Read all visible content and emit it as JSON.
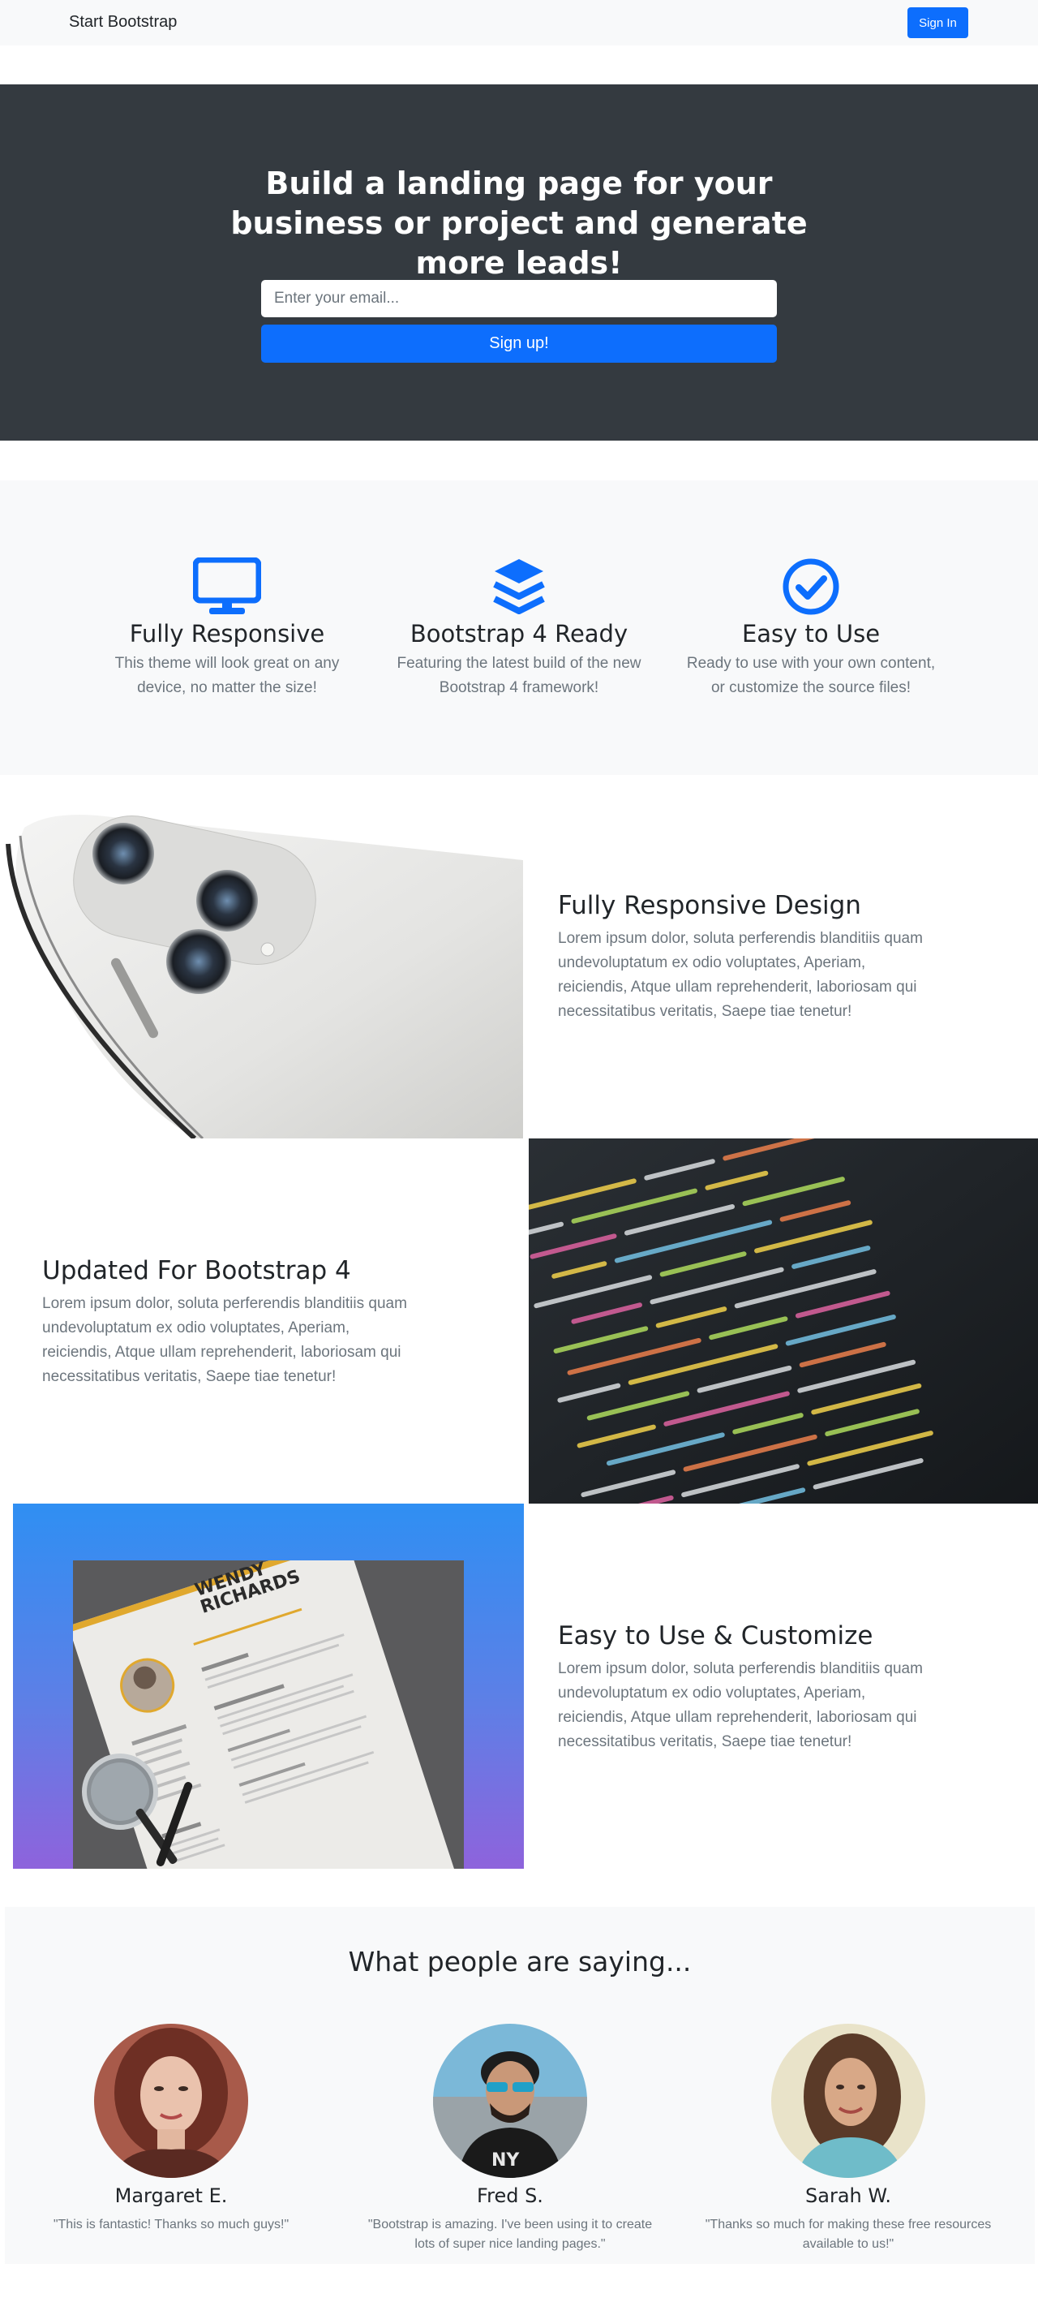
{
  "navbar": {
    "brand": "Start Bootstrap",
    "signin_label": "Sign In"
  },
  "hero": {
    "title": "Build a landing page for your business or project and generate more leads!",
    "email_placeholder": "Enter your email...",
    "signup_label": "Sign up!"
  },
  "features": [
    {
      "icon": "desktop-icon",
      "title": "Fully Responsive",
      "text": "This theme will look great on any device, no matter the size!"
    },
    {
      "icon": "layers-icon",
      "title": "Bootstrap 4 Ready",
      "text": "Featuring the latest build of the new Bootstrap 4 framework!"
    },
    {
      "icon": "check-circle-icon",
      "title": "Easy to Use",
      "text": "Ready to use with your own content, or customize the source files!"
    }
  ],
  "showcases": [
    {
      "title": "Fully Responsive Design",
      "text": "Lorem ipsum dolor, soluta perferendis blanditiis quam undevoluptatum ex odio voluptates, Aperiam, reiciendis, Atque ullam reprehenderit, laboriosam qui necessitatibus veritatis, Saepe tiae tenetur!",
      "image": "phone-photo"
    },
    {
      "title": "Updated For Bootstrap 4",
      "text": "Lorem ipsum dolor, soluta perferendis blanditiis quam undevoluptatum ex odio voluptates, Aperiam, reiciendis, Atque ullam reprehenderit, laboriosam qui necessitatibus veritatis, Saepe tiae tenetur!",
      "image": "code-photo"
    },
    {
      "title": "Easy to Use & Customize",
      "text": "Lorem ipsum dolor, soluta perferendis blanditiis quam undevoluptatum ex odio voluptates, Aperiam, reiciendis, Atque ullam reprehenderit, laboriosam qui necessitatibus veritatis, Saepe tiae tenetur!",
      "image": "resume-photo"
    }
  ],
  "resume_image": {
    "name": "WENDY RICHARDS"
  },
  "testimonials": {
    "title": "What people are saying...",
    "items": [
      {
        "name": "Margaret E.",
        "quote": "\"This is fantastic! Thanks so much guys!\""
      },
      {
        "name": "Fred S.",
        "quote": "\"Bootstrap is amazing. I've been using it to create lots of super nice landing pages.\""
      },
      {
        "name": "Sarah W.",
        "quote": "\"Thanks so much for making these free resources available to us!\""
      }
    ]
  },
  "colors": {
    "primary": "#0d6efd",
    "dark": "#343a40",
    "light": "#f8f9fa",
    "muted": "#6c757d"
  }
}
